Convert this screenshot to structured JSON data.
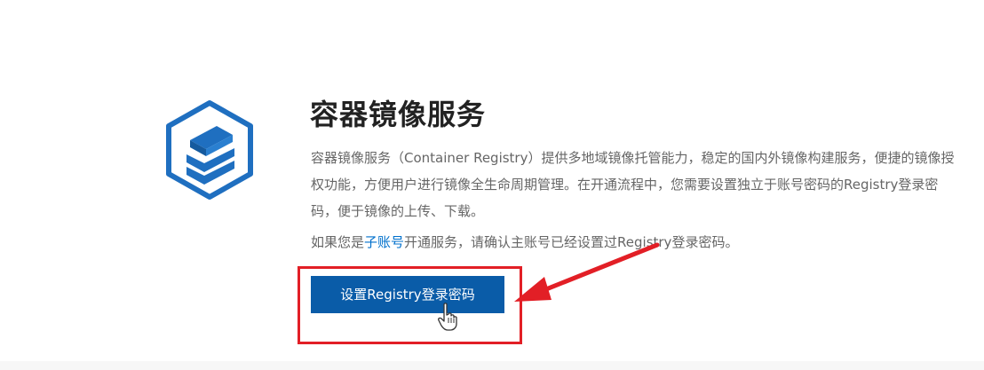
{
  "service": {
    "logo_icon": "container-registry-hexagon-icon",
    "title": "容器镜像服务",
    "description": "容器镜像服务（Container Registry）提供多地域镜像托管能力，稳定的国内外镜像构建服务，便捷的镜像授权功能，方便用户进行镜像全生命周期管理。在开通流程中，您需要设置独立于账号密码的Registry登录密码，便于镜像的上传、下载。",
    "notice": {
      "prefix": "如果您是",
      "link": "子账号",
      "suffix": "开通服务，请确认主账号已经设置过Registry登录密码。"
    },
    "primary_button": "设置Registry登录密码"
  },
  "annotations": {
    "highlight_color": "#e21f26",
    "arrow_icon": "red-arrow-icon",
    "cursor_icon": "hand-pointer-cursor-icon"
  },
  "colors": {
    "brand_blue": "#0a5ca8",
    "link_blue": "#0070cc",
    "logo_blue": "#1f6fc0"
  }
}
